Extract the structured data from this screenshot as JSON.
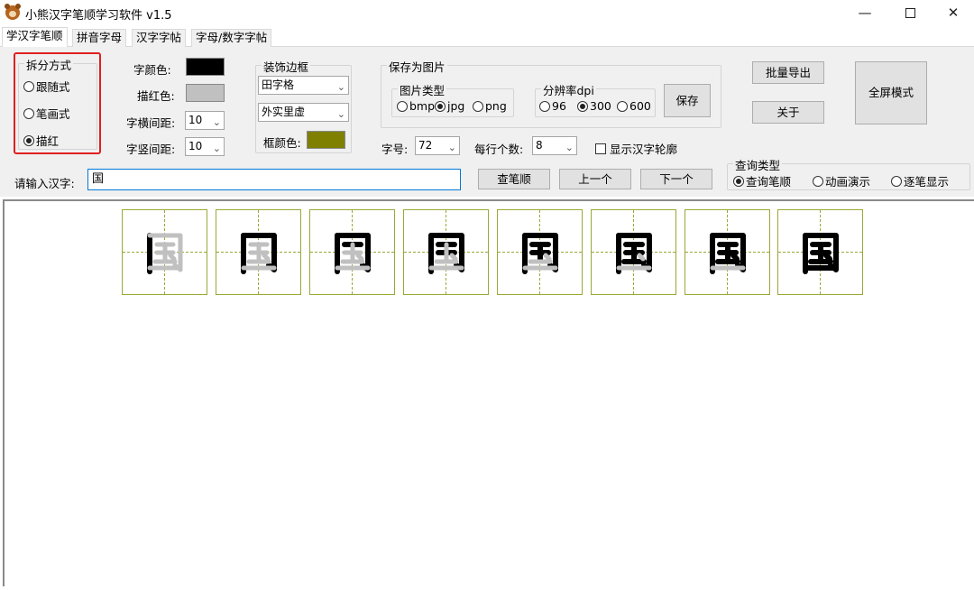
{
  "window": {
    "title": "小熊汉字笔顺学习软件 v1.5",
    "min": "—",
    "close": "✕"
  },
  "tabs": [
    "学汉字笔顺",
    "拼音字母",
    "汉字字帖",
    "字母/数字字帖"
  ],
  "split_mode": {
    "legend": "拆分方式",
    "options": [
      {
        "label": "跟随式",
        "selected": false
      },
      {
        "label": "笔画式",
        "selected": false
      },
      {
        "label": "描红",
        "selected": true
      }
    ]
  },
  "colors": {
    "char_color_label": "字颜色:",
    "char_color": "#000000",
    "trace_color_label": "描红色:",
    "trace_color": "#c0c0c0",
    "h_spacing_label": "字横间距:",
    "h_spacing": "10",
    "v_spacing_label": "字竖间距:",
    "v_spacing": "10"
  },
  "frame": {
    "legend": "装饰边框",
    "grid_type": "田字格",
    "line_style": "外实里虚",
    "frame_color_label": "框颜色:",
    "frame_color": "#808000"
  },
  "save_image": {
    "legend": "保存为图片",
    "type_legend": "图片类型",
    "types": [
      {
        "label": "bmp",
        "selected": false
      },
      {
        "label": "jpg",
        "selected": true
      },
      {
        "label": "png",
        "selected": false
      }
    ],
    "dpi_legend": "分辨率dpi",
    "dpis": [
      {
        "label": "96",
        "selected": false
      },
      {
        "label": "300",
        "selected": true
      },
      {
        "label": "600",
        "selected": false
      }
    ],
    "save_button": "保存"
  },
  "font_size_label": "字号:",
  "font_size": "72",
  "per_row_label": "每行个数:",
  "per_row": "8",
  "outline_checkbox": {
    "label": "显示汉字轮廓",
    "checked": false
  },
  "buttons": {
    "batch_export": "批量导出",
    "about": "关于",
    "fullscreen": "全屏模式",
    "lookup": "查笔顺",
    "prev": "上一个",
    "next": "下一个"
  },
  "input": {
    "label": "请输入汉字:",
    "value": "国"
  },
  "query_type": {
    "legend": "查询类型",
    "options": [
      {
        "label": "查询笔顺",
        "selected": true
      },
      {
        "label": "动画演示",
        "selected": false
      },
      {
        "label": "逐笔显示",
        "selected": false
      }
    ]
  },
  "stroke_cells": {
    "character": "国",
    "frames": [
      {
        "dark": "丨",
        "full": "国"
      },
      {
        "dark": "冂",
        "full": "国"
      },
      {
        "dark": "冂一",
        "full": "国"
      },
      {
        "dark": "冂二",
        "full": "国"
      },
      {
        "dark": "冂王",
        "full": "国"
      },
      {
        "dark": "冂王",
        "full": "国"
      },
      {
        "dark": "国",
        "full": "国"
      },
      {
        "dark": "国",
        "full": "国"
      }
    ],
    "drawn_strokes": [
      1,
      2,
      3,
      4,
      5,
      6,
      7,
      8
    ]
  }
}
